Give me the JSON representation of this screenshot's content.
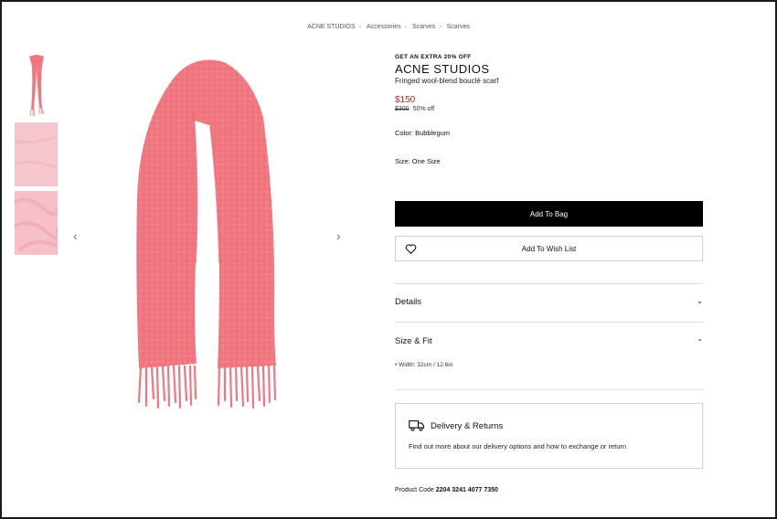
{
  "breadcrumb": [
    "ACNE STUDIOS",
    "Accessories",
    "Scarves",
    "Scarves"
  ],
  "product": {
    "promo": "GET AN EXTRA 20% OFF",
    "brand": "ACNE STUDIOS",
    "name": "Fringed wool-blend bouclé scarf",
    "price": "$150",
    "original_price": "$300",
    "discount": "50% off",
    "color_label": "Color: Bubblegum",
    "size_label": "Size: One Size"
  },
  "buttons": {
    "add_to_bag": "Add To Bag",
    "add_to_wishlist": "Add To Wish List"
  },
  "accordion": {
    "details": "Details",
    "size_fit": "Size & Fit",
    "size_fit_bullet": "• Width: 32cm / 12.6in"
  },
  "delivery": {
    "title": "Delivery & Returns",
    "text": "Find out more about our delivery options and how to exchange or return"
  },
  "product_code": {
    "label": "Product Code",
    "value": "2204 3241 4077 7350"
  },
  "colors": {
    "scarf": "#f17680",
    "price_red": "#b3201f",
    "button_black": "#000000"
  }
}
